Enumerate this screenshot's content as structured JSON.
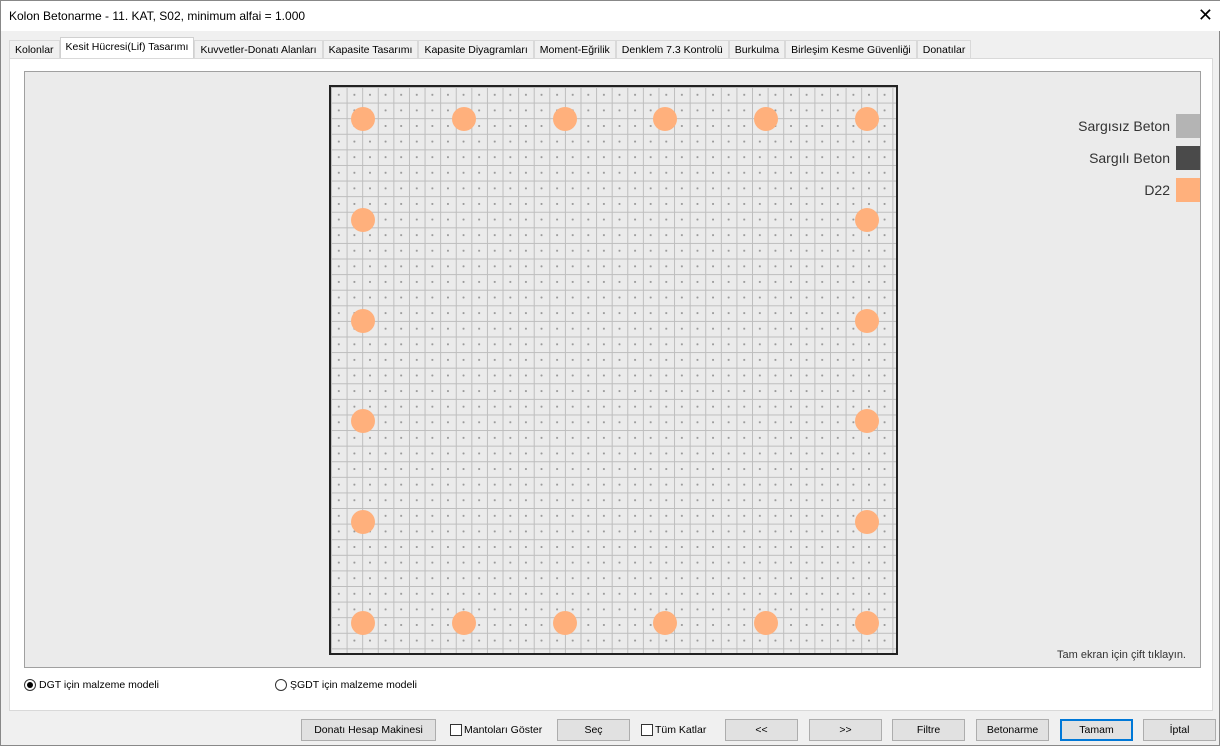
{
  "window": {
    "title": "Kolon Betonarme - 11. KAT, S02, minimum alfai = 1.000",
    "close": "✕"
  },
  "tabs": [
    "Kolonlar",
    "Kesit Hücresi(Lif) Tasarımı",
    "Kuvvetler-Donatı Alanları",
    "Kapasite Tasarımı",
    "Kapasite Diyagramları",
    "Moment-Eğrilik",
    "Denklem 7.3 Kontrolü",
    "Burkulma",
    "Birleşim Kesme Güvenliği",
    "Donatılar"
  ],
  "active_tab": 1,
  "legend": [
    {
      "label": "Sargısız Beton",
      "color": "#b4b4b4"
    },
    {
      "label": "Sargılı Beton",
      "color": "#4a4a4a"
    },
    {
      "label": "D22",
      "color": "#ffb07c"
    }
  ],
  "hint": "Tam ekran için çift tıklayın.",
  "radios": [
    {
      "label": "DGT için malzeme modeli",
      "checked": true
    },
    {
      "label": "ŞGDT için malzeme modeli",
      "checked": false
    }
  ],
  "buttons": {
    "calc": "Donatı Hesap Makinesi",
    "mantolar": "Mantoları Göster",
    "sec": "Seç",
    "tum_katlar": "Tüm Katlar",
    "prev": "<<",
    "next": ">>",
    "filtre": "Filtre",
    "betonarme": "Betonarme",
    "tamam": "Tamam",
    "iptal": "İptal"
  }
}
